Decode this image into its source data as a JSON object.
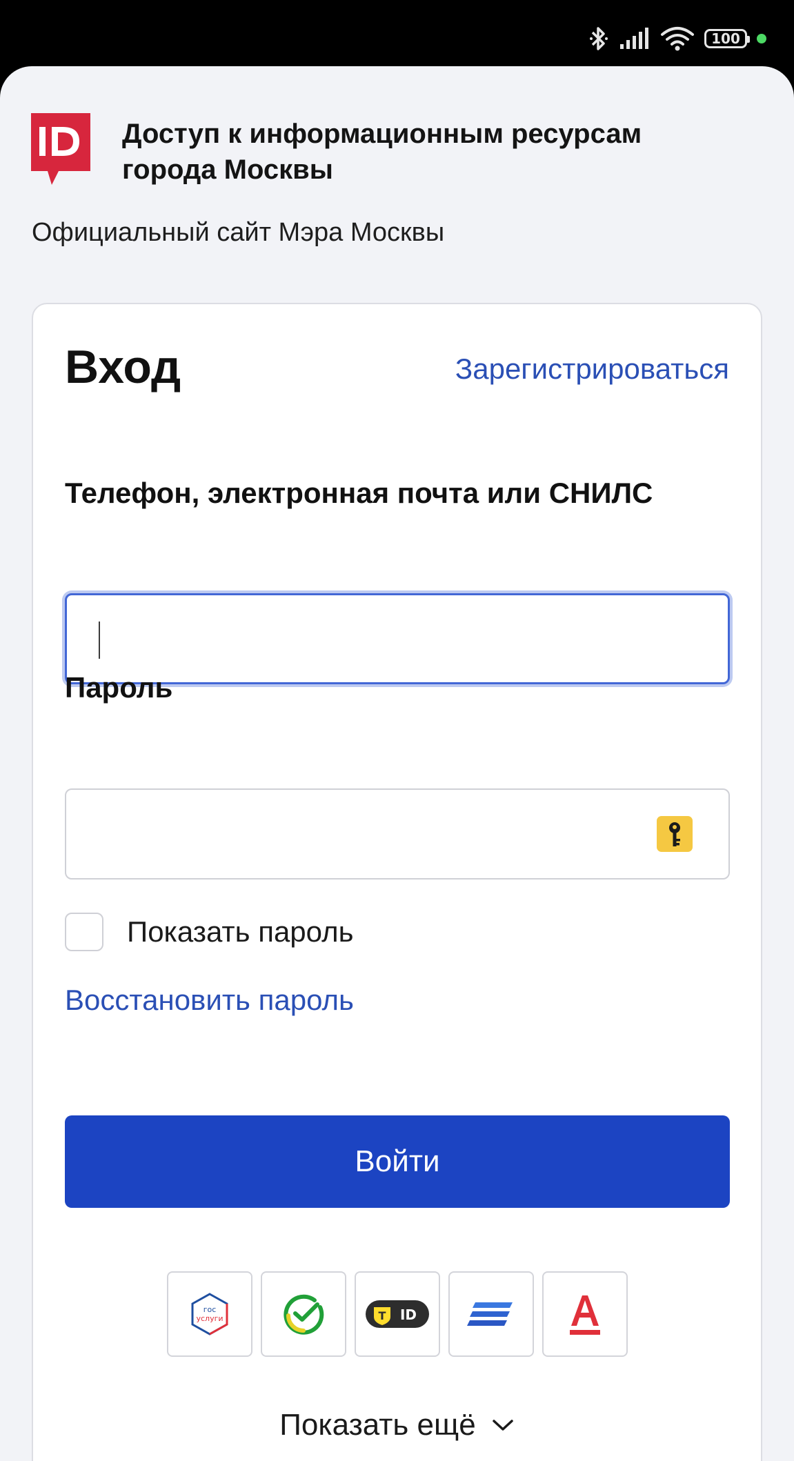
{
  "status_bar": {
    "battery_level": "100",
    "icons": [
      "bluetooth-icon",
      "signal-icon",
      "wifi-icon",
      "battery-icon",
      "indicator-dot"
    ]
  },
  "header": {
    "logo_text": "ID",
    "title": "Доступ к информационным ресурсам города Москвы",
    "subtitle": "Официальный сайт Мэра Москвы"
  },
  "login_form": {
    "title": "Вход",
    "register_link": "Зарегистрироваться",
    "login_label": "Телефон, электронная почта или СНИЛС",
    "login_value": "",
    "password_label": "Пароль",
    "password_value": "",
    "show_password_label": "Показать пароль",
    "show_password_checked": false,
    "restore_password_link": "Восстановить пароль",
    "submit_label": "Войти"
  },
  "providers": [
    {
      "name": "gosuslugi",
      "icon": "gosuslugi-icon",
      "text": "гос услуги"
    },
    {
      "name": "sber",
      "icon": "sber-icon"
    },
    {
      "name": "tinkoff",
      "icon": "tinkoff-id-icon",
      "text": "ID"
    },
    {
      "name": "vtb",
      "icon": "vtb-icon"
    },
    {
      "name": "alfa",
      "icon": "alfa-bank-icon",
      "text": "А"
    }
  ],
  "show_more_label": "Показать ещё",
  "colors": {
    "brand_red": "#d7263d",
    "link_blue": "#2a4fb5",
    "button_blue": "#1c44c2",
    "focus_blue": "#4267d6",
    "key_yellow": "#f5c842",
    "background": "#f2f3f7"
  }
}
